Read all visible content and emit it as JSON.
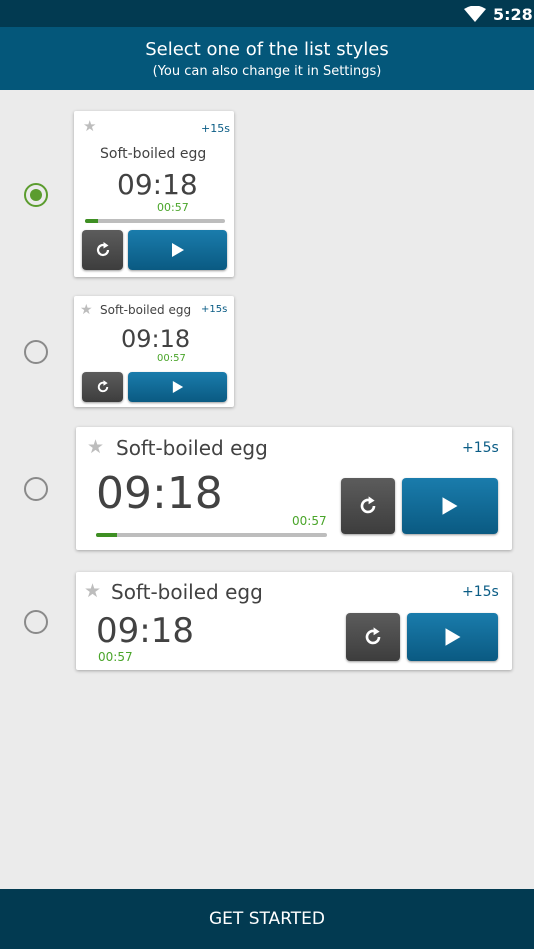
{
  "status_bar": {
    "time": "5:28",
    "wifi_icon": "wifi-icon"
  },
  "header": {
    "title": "Select one of the list styles",
    "subtitle": "(You can also change it in Settings)"
  },
  "styles": [
    {
      "selected": true,
      "name": "Soft-boiled egg",
      "plus_label": "+15s",
      "time": "09:18",
      "remaining": "00:57",
      "progress": 0.09
    },
    {
      "selected": false,
      "name": "Soft-boiled egg",
      "plus_label": "+15s",
      "time": "09:18",
      "remaining": "00:57"
    },
    {
      "selected": false,
      "name": "Soft-boiled egg",
      "plus_label": "+15s",
      "time": "09:18",
      "remaining": "00:57",
      "progress": 0.09
    },
    {
      "selected": false,
      "name": "Soft-boiled egg",
      "plus_label": "+15s",
      "time": "09:18",
      "remaining": "00:57"
    }
  ],
  "icons": {
    "star": "star-icon",
    "reset": "refresh-icon",
    "play": "play-icon"
  },
  "colors": {
    "primary": "#04577a",
    "dark": "#023a51",
    "accent_green": "#4aa52a",
    "radio_selected": "#5b9c2e"
  },
  "footer": {
    "button_label": "GET STARTED"
  }
}
